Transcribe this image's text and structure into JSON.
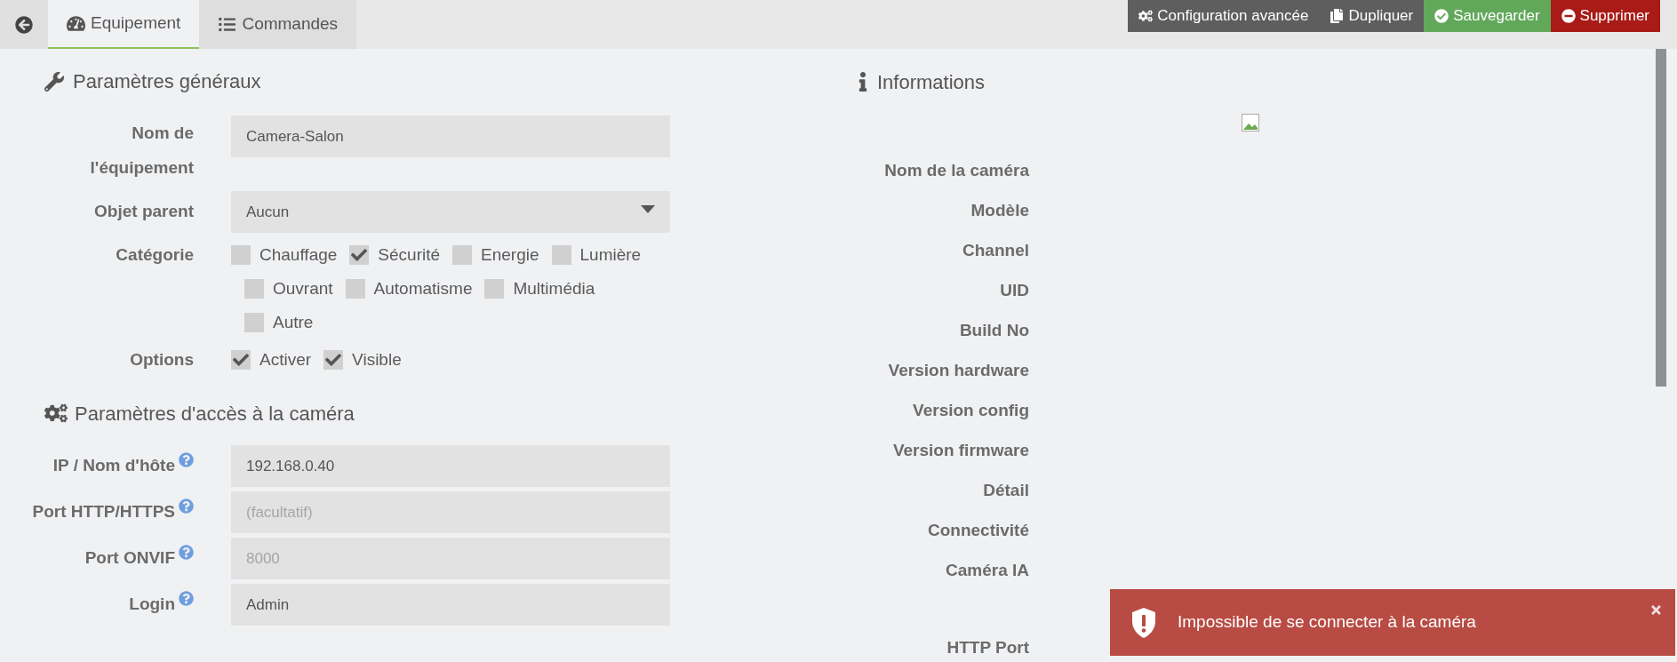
{
  "tabs": [
    {
      "label": "Equipement",
      "kind": "equipment",
      "selected": true
    },
    {
      "label": "Commandes",
      "kind": "commands",
      "selected": false
    }
  ],
  "actions": [
    {
      "label": "Configuration avancée",
      "kind": "config"
    },
    {
      "label": "Dupliquer",
      "kind": "duplicate"
    },
    {
      "label": "Sauvegarder",
      "kind": "save"
    },
    {
      "label": "Supprimer",
      "kind": "delete"
    }
  ],
  "general": {
    "title": "Paramètres généraux",
    "name_field": {
      "label_lines": [
        "Nom de",
        "l'équipement"
      ],
      "value": "Camera-Salon"
    },
    "parent_field": {
      "label": "Objet parent",
      "value": "Aucun"
    },
    "category": {
      "label": "Catégorie",
      "rows": [
        {
          "items": [
            {
              "label": "Chauffage",
              "checked": false
            },
            {
              "label": "Sécurité",
              "checked": true
            },
            {
              "label": "Energie",
              "checked": false
            },
            {
              "label": "Lumière",
              "checked": false
            }
          ]
        },
        {
          "items": [
            {
              "label": "Ouvrant",
              "checked": false
            },
            {
              "label": "Automatisme",
              "checked": false
            },
            {
              "label": "Multimédia",
              "checked": false
            }
          ]
        },
        {
          "items": [
            {
              "label": "Autre",
              "checked": false
            }
          ]
        }
      ]
    },
    "options": {
      "label": "Options",
      "items": [
        {
          "label": "Activer",
          "checked": true
        },
        {
          "label": "Visible",
          "checked": true
        }
      ]
    }
  },
  "access": {
    "title": "Paramètres d'accès à la caméra",
    "fields": [
      {
        "label": "IP / Nom d'hôte",
        "value": "192.168.0.40",
        "help": true
      },
      {
        "label": "Port HTTP/HTTPS",
        "placeholder": "(facultatif)",
        "help": true
      },
      {
        "label": "Port ONVIF",
        "placeholder": "8000",
        "help": true
      },
      {
        "label": "Login",
        "value": "Admin",
        "help": true
      }
    ]
  },
  "info": {
    "title": "Informations",
    "labels": [
      "Nom de la caméra",
      "Modèle",
      "Channel",
      "UID",
      "Build No",
      "Version hardware",
      "Version config",
      "Version firmware",
      "Détail",
      "Connectivité",
      "Caméra IA"
    ],
    "last_label": "HTTP Port"
  },
  "toast": {
    "message": "Impossible de se connecter à la caméra"
  }
}
